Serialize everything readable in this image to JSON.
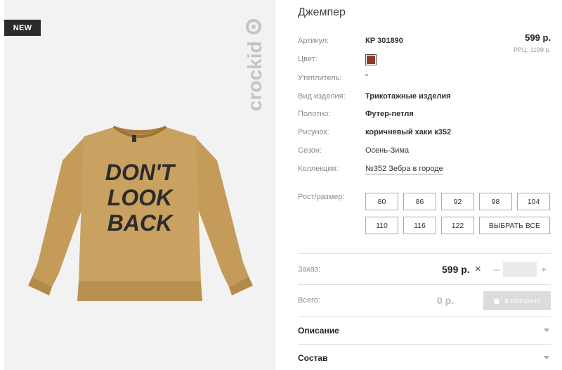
{
  "badge": "NEW",
  "brand": "crockid",
  "product_image": {
    "print_lines": [
      "DON'T",
      "LOOK",
      "BACK"
    ],
    "garment_color": "#c9a160"
  },
  "product": {
    "title": "Джемпер",
    "price": "599 р.",
    "rrp": "РРЦ: 1199 р.",
    "attributes": [
      {
        "label": "Артикул:",
        "value": "КР 301890",
        "style": "bold"
      },
      {
        "label": "Цвет:",
        "value": "",
        "style": "swatch"
      },
      {
        "label": "Утеплитель:",
        "value": "\"",
        "style": "normal"
      },
      {
        "label": "Вид изделия:",
        "value": "Трикотажные изделия",
        "style": "bold"
      },
      {
        "label": "Полотно:",
        "value": "Футер-петля",
        "style": "bold"
      },
      {
        "label": "Рисунок:",
        "value": "коричневый хаки к352",
        "style": "bold"
      },
      {
        "label": "Сезон:",
        "value": "Осень-Зима",
        "style": "normal"
      },
      {
        "label": "Коллекция:",
        "value": "№352 Зебра в городе",
        "style": "link"
      }
    ],
    "color_swatch": "#8b3e2a"
  },
  "sizes": {
    "label": "Рост/размер:",
    "options": [
      "80",
      "86",
      "92",
      "98",
      "104",
      "110",
      "116",
      "122"
    ],
    "select_all": "ВЫБРАТЬ ВСЕ"
  },
  "order": {
    "label": "Заказ:",
    "price": "599 р.",
    "times": "×",
    "minus": "–",
    "plus": "+",
    "quantity": ""
  },
  "total": {
    "label": "Всего:",
    "value": "0 р.",
    "cart_button": "В КОРЗИНУ"
  },
  "accordions": [
    {
      "title": "Описание"
    },
    {
      "title": "Состав"
    }
  ]
}
